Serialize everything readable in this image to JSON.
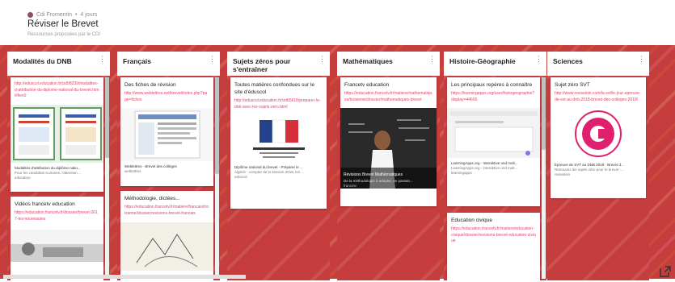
{
  "header": {
    "crumb_author": "Cdi Fromentin",
    "crumb_age": "4 jours",
    "title": "Réviser le Brevet",
    "subtitle": "Ressources proposées par le CDI"
  },
  "columns": [
    {
      "title": "Modalités du DNB",
      "cards": [
        {
          "link": "http://eduscol.education.fr/cid98239/modalites-d-attribution-du-diplome-national-du-brevet.html#lien0",
          "caption": "Modalités d'attribution du diplôme natio...",
          "caption2": "Pour les candidats scolaires, l'attention ...",
          "caption3": "education"
        },
        {
          "title": "Vidéos francetv education",
          "link": "https://education.francetv.fr/dossier/brevet-2017-les-nouveautes"
        }
      ]
    },
    {
      "title": "Français",
      "cards": [
        {
          "title": "Des fiches de révision",
          "link": "http://www.weblettres.net/brevet/index.php?page=fiches",
          "caption": "Weblettres - Brevet des collèges",
          "caption2": "weblettres"
        },
        {
          "title": "Méthodologie, dictées...",
          "link": "https://education.francetv.fr/matiere/francais/troisieme/dossier/revisions-brevet-francais"
        }
      ]
    },
    {
      "title": "Sujets zéros pour s'entraîner",
      "cards": [
        {
          "title": "Toutes matières confondues sur le site d'éduscol",
          "link": "http://eduscol.education.fr/cid65618/preparer-le-dnb-avec-les-sujets-zero.html",
          "caption": "Diplôme national du brevet - Préparer le ...",
          "caption2": "Algérie : compter de la session 2018, les ...",
          "caption3": "eduscol"
        }
      ]
    },
    {
      "title": "Mathématiques",
      "cards": [
        {
          "title": "Francetv education",
          "link": "https://education.francetv.fr/matiere/mathematiques/troisieme/dossier/mathematiques-brevet",
          "caption": "Révisions Brevet Mathématiques",
          "caption2": "De la méthodologie à adopter, en passan...",
          "caption3": "francetv"
        }
      ]
    },
    {
      "title": "Histoire-Géographie",
      "cards": [
        {
          "title": "Les principaux repères à connaître",
          "link": "https://learningapps.org/user/histogeographie?display=44665",
          "caption": "LearningApps.org - Interaktive und mult...",
          "caption2": "LearningApps.org - interaktive und mult...",
          "caption3": "learningapps"
        },
        {
          "title": "Education civique",
          "link": "https://education.francetv.fr/matiere/education-civique/dossier/revisions-brevet-education-civique"
        }
      ]
    },
    {
      "title": "Sciences",
      "cards": [
        {
          "title": "Sujet zéro SVT",
          "link": "http://www.reviseloin.com/la-svt/le-jour-epreuve-de-svt-au-dnb-2018-brevet-des-colleges-2018/",
          "caption": "Epreuve de SVT au DNB 2018 - Brevet d...",
          "caption2": "Retrouvez les sujets zéro pour le brevet -...",
          "caption3": "reviseloin"
        }
      ]
    }
  ],
  "icons": {
    "external": "external-link-icon",
    "kebab": "more-vert-icon"
  },
  "colors": {
    "board": "#c63d3d",
    "link": "#e0456b",
    "accent": "#8e4f63"
  }
}
